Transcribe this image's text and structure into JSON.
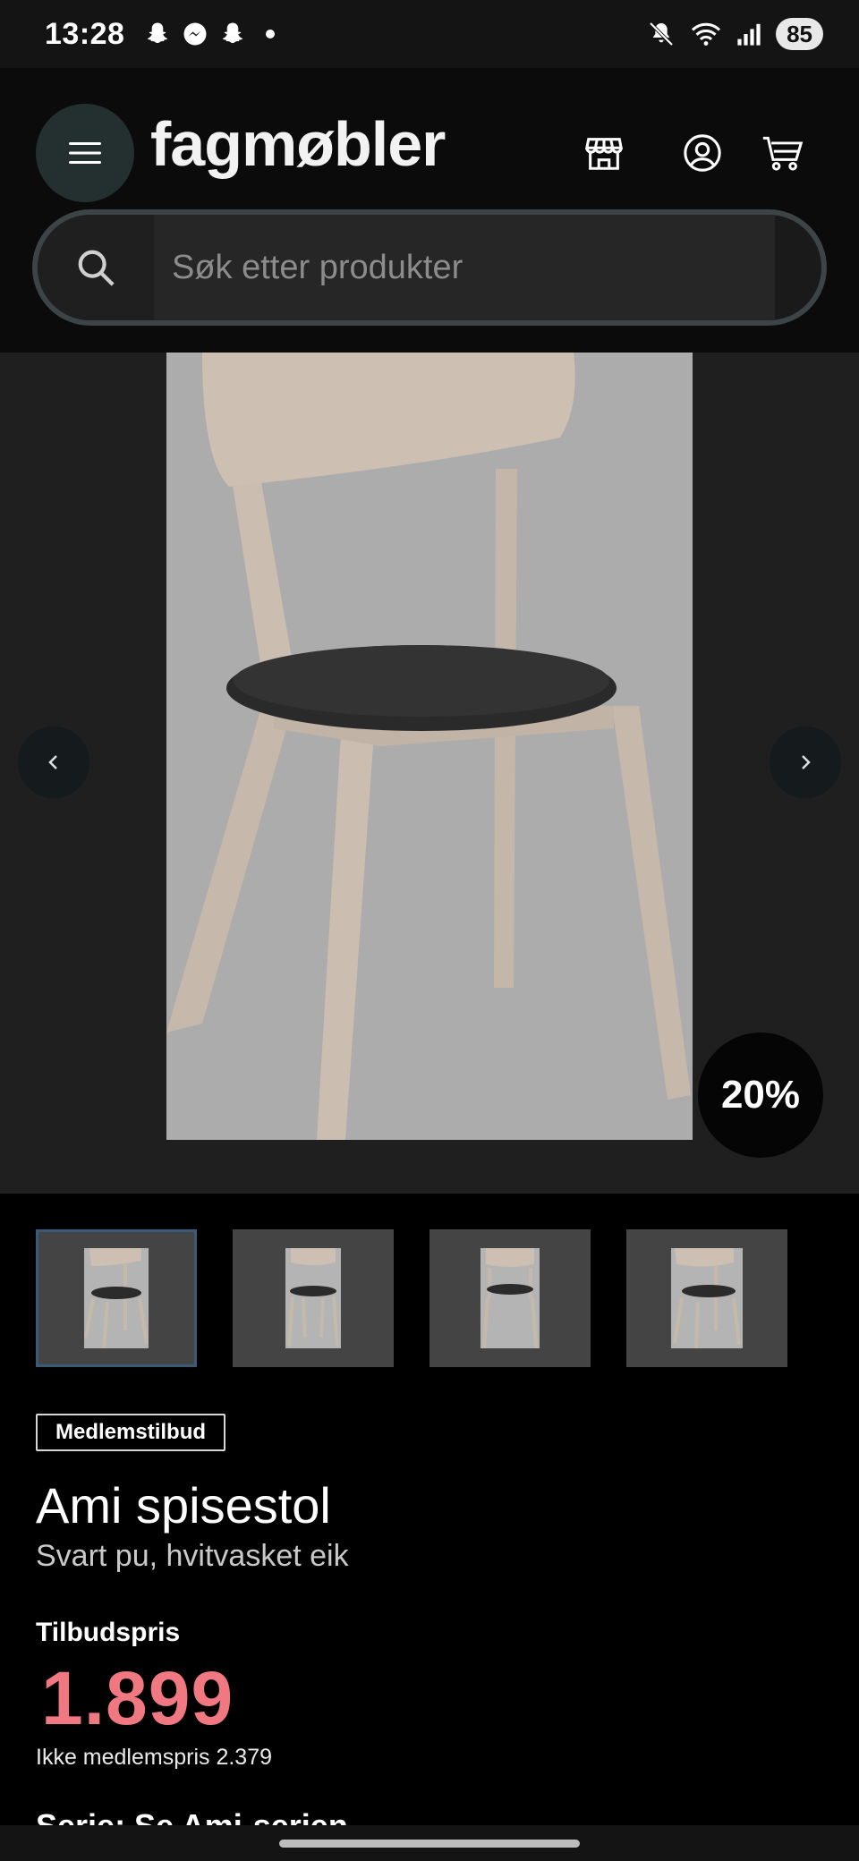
{
  "status_bar": {
    "time": "13:28",
    "left_icons": [
      "snapchat-icon",
      "messenger-icon",
      "snapchat-icon",
      "dot"
    ],
    "right_icons": [
      "mute-icon",
      "wifi-icon",
      "signal-icon"
    ],
    "battery": "85"
  },
  "header": {
    "logo": "fagmøbler",
    "icons": [
      "menu-icon",
      "store-icon",
      "account-icon",
      "cart-icon"
    ]
  },
  "search": {
    "placeholder": "Søk etter produkter",
    "value": ""
  },
  "gallery": {
    "discount": "20%",
    "thumbnail_count": 4,
    "active_thumbnail": 1
  },
  "product": {
    "badge": "Medlemstilbud",
    "title": "Ami spisestol",
    "subtitle": "Svart pu, hvitvasket eik",
    "price_label": "Tilbudspris",
    "price": "1.899",
    "nonmember_price": "Ikke medlemspris 2.379",
    "series": "Serie: Se Ami-serien"
  },
  "colors": {
    "accent_price": "#f07880",
    "header_bg": "#0b0b0b",
    "gallery_bg": "#1f1f1f"
  }
}
